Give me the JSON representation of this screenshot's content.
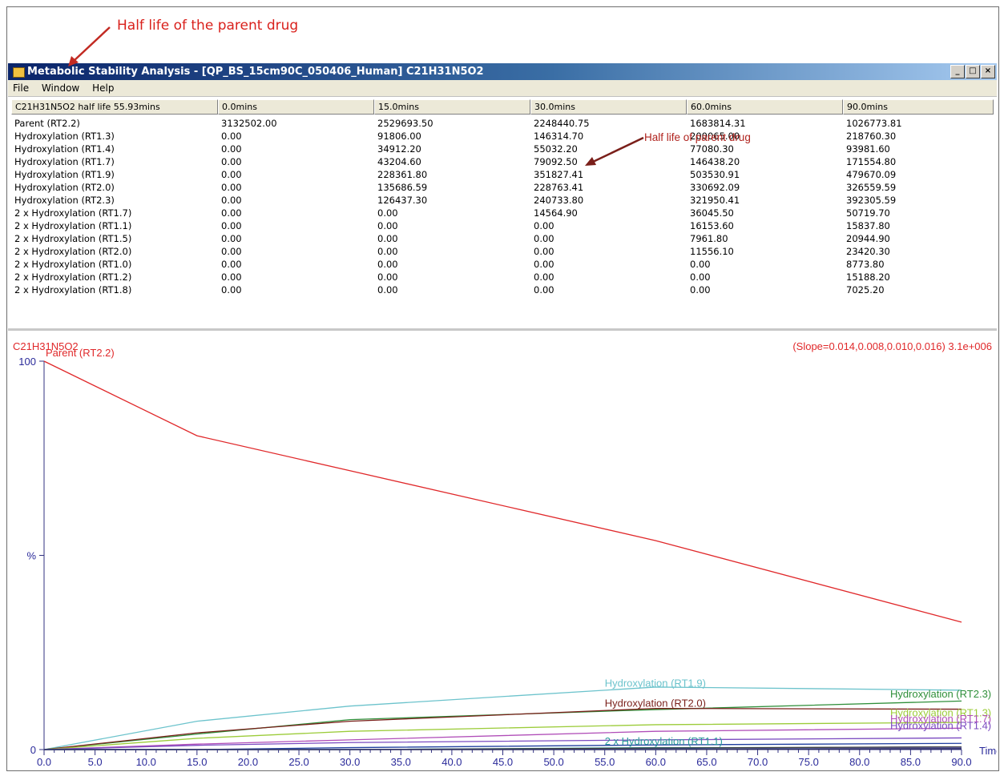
{
  "annotation_top": "Half life of the parent drug",
  "annotation_inner": "Half life of parent drug",
  "window": {
    "title": "Metabolic Stability Analysis - [QP_BS_15cm90C_050406_Human] C21H31N5O2",
    "buttons": [
      "_",
      "□",
      "×"
    ]
  },
  "menu": [
    "File",
    "Window",
    "Help"
  ],
  "table": {
    "headers": [
      "C21H31N5O2 half life 55.93mins",
      "0.0mins",
      "15.0mins",
      "30.0mins",
      "60.0mins",
      "90.0mins"
    ],
    "rows": [
      [
        "Parent (RT2.2)",
        "3132502.00",
        "2529693.50",
        "2248440.75",
        "1683814.31",
        "1026773.81"
      ],
      [
        "Hydroxylation (RT1.3)",
        "0.00",
        "91806.00",
        "146314.70",
        "200065.00",
        "218760.30"
      ],
      [
        "Hydroxylation (RT1.4)",
        "0.00",
        "34912.20",
        "55032.20",
        "77080.30",
        "93981.60"
      ],
      [
        "Hydroxylation (RT1.7)",
        "0.00",
        "43204.60",
        "79092.50",
        "146438.20",
        "171554.80"
      ],
      [
        "Hydroxylation (RT1.9)",
        "0.00",
        "228361.80",
        "351827.41",
        "503530.91",
        "479670.09"
      ],
      [
        "Hydroxylation (RT2.0)",
        "0.00",
        "135686.59",
        "228763.41",
        "330692.09",
        "326559.59"
      ],
      [
        "Hydroxylation (RT2.3)",
        "0.00",
        "126437.30",
        "240733.80",
        "321950.41",
        "392305.59"
      ],
      [
        "2 x Hydroxylation (RT1.7)",
        "0.00",
        "0.00",
        "14564.90",
        "36045.50",
        "50719.70"
      ],
      [
        "2 x Hydroxylation (RT1.1)",
        "0.00",
        "0.00",
        "0.00",
        "16153.60",
        "15837.80"
      ],
      [
        "2 x Hydroxylation (RT1.5)",
        "0.00",
        "0.00",
        "0.00",
        "7961.80",
        "20944.90"
      ],
      [
        "2 x Hydroxylation (RT2.0)",
        "0.00",
        "0.00",
        "0.00",
        "11556.10",
        "23420.30"
      ],
      [
        "2 x Hydroxylation (RT1.0)",
        "0.00",
        "0.00",
        "0.00",
        "0.00",
        "8773.80"
      ],
      [
        "2 x Hydroxylation (RT1.2)",
        "0.00",
        "0.00",
        "0.00",
        "0.00",
        "15188.20"
      ],
      [
        "2 x Hydroxylation (RT1.8)",
        "0.00",
        "0.00",
        "0.00",
        "0.00",
        "7025.20"
      ]
    ]
  },
  "chart_data": {
    "type": "line",
    "title": "C21H31N5O2",
    "subtitle": "(Slope=0.014,0.008,0.010,0.016) 3.1e+006",
    "xlabel": "Time",
    "ylabel": "%",
    "xlim": [
      0,
      90
    ],
    "ylim": [
      0,
      100
    ],
    "x_ticks": [
      "0.0",
      "5.0",
      "10.0",
      "15.0",
      "20.0",
      "25.0",
      "30.0",
      "35.0",
      "40.0",
      "45.0",
      "50.0",
      "55.0",
      "60.0",
      "65.0",
      "70.0",
      "75.0",
      "80.0",
      "85.0",
      "90.0"
    ],
    "y_ticks": [
      "0",
      "%",
      "100"
    ],
    "x": [
      0,
      15,
      30,
      60,
      90
    ],
    "series": [
      {
        "name": "Parent (RT2.2)",
        "color": "#e0282a",
        "values": [
          100,
          80.8,
          71.8,
          53.8,
          32.8
        ]
      },
      {
        "name": "Hydroxylation (RT1.9)",
        "color": "#6cc3cc",
        "values": [
          0,
          7.3,
          11.2,
          16.1,
          15.3
        ]
      },
      {
        "name": "Hydroxylation (RT2.3)",
        "color": "#2f8f3a",
        "values": [
          0,
          4.0,
          7.7,
          10.3,
          12.5
        ]
      },
      {
        "name": "Hydroxylation (RT2.0)",
        "color": "#7a1f1a",
        "values": [
          0,
          4.3,
          7.3,
          10.6,
          10.4
        ]
      },
      {
        "name": "Hydroxylation (RT1.3)",
        "color": "#9ccc3a",
        "values": [
          0,
          2.9,
          4.7,
          6.4,
          7.0
        ]
      },
      {
        "name": "Hydroxylation (RT1.7)",
        "color": "#b04db8",
        "values": [
          0,
          1.4,
          2.5,
          4.7,
          5.5
        ]
      },
      {
        "name": "Hydroxylation (RT1.4)",
        "color": "#7a4ac0",
        "values": [
          0,
          1.1,
          1.8,
          2.5,
          3.0
        ]
      },
      {
        "name": "2 x Hydroxylation (RT1.7)",
        "color": "#1f3f9f",
        "values": [
          0,
          0,
          0.5,
          1.2,
          1.6
        ]
      },
      {
        "name": "2 x Hydroxylation (RT1.1)",
        "color": "#2a9a9a",
        "values": [
          0,
          0,
          0,
          0.5,
          0.5
        ]
      },
      {
        "name": "2 x Hydroxylation (RT1.5)",
        "color": "#3050b0",
        "values": [
          0,
          0,
          0,
          0.3,
          0.7
        ]
      },
      {
        "name": "2 x Hydroxylation (RT2.0)",
        "color": "#404040",
        "values": [
          0,
          0,
          0,
          0.4,
          0.7
        ]
      },
      {
        "name": "2 x Hydroxylation (RT1.0)",
        "color": "#505090",
        "values": [
          0,
          0,
          0,
          0,
          0.3
        ]
      },
      {
        "name": "2 x Hydroxylation (RT1.2)",
        "color": "#6060a0",
        "values": [
          0,
          0,
          0,
          0,
          0.5
        ]
      },
      {
        "name": "2 x Hydroxylation (RT1.8)",
        "color": "#303060",
        "values": [
          0,
          0,
          0,
          0,
          0.2
        ]
      }
    ],
    "labels": [
      {
        "text": "Parent (RT2.2)",
        "series": 0,
        "color": "#e0282a"
      },
      {
        "text": "Hydroxylation (RT1.9)",
        "series": 1,
        "color": "#6cc3cc"
      },
      {
        "text": "Hydroxylation (RT2.3)",
        "series": 2,
        "color": "#2f8f3a"
      },
      {
        "text": "Hydroxylation (RT2.0)",
        "series": 3,
        "color": "#7a1f1a"
      },
      {
        "text": "Hydroxylation (RT1.3)",
        "series": 4,
        "color": "#9ccc3a"
      },
      {
        "text": "Hydroxylation (RT1.7)",
        "series": 5,
        "color": "#b04db8"
      },
      {
        "text": "Hydroxylation (RT1.4)",
        "series": 6,
        "color": "#7a4ac0"
      },
      {
        "text": "2 x Hydroxylation (RT1.1)",
        "series": 8,
        "color": "#2a9a9a"
      }
    ]
  }
}
